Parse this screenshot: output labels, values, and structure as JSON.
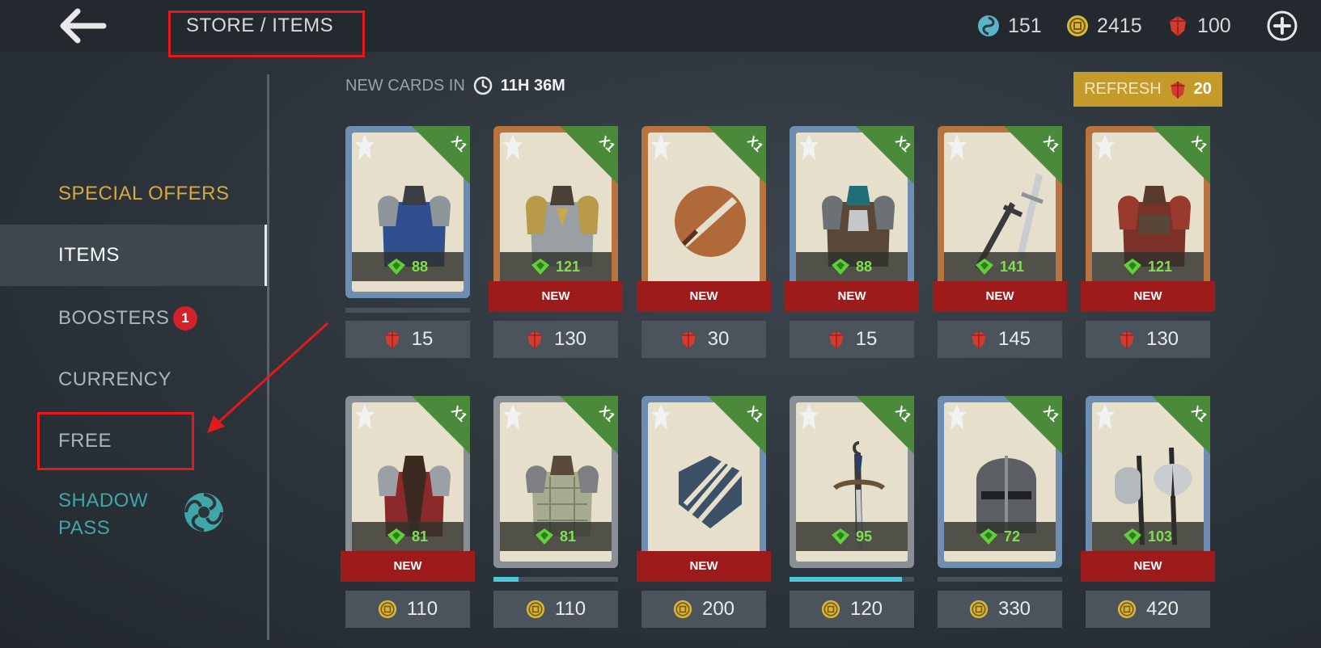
{
  "header": {
    "title": "STORE / ITEMS",
    "currencies": [
      {
        "name": "shadow-energy",
        "value": "151",
        "color": "#5bb3c8"
      },
      {
        "name": "coins",
        "value": "2415",
        "color": "#d8b53b"
      },
      {
        "name": "gems",
        "value": "100",
        "color": "#d23b2e"
      }
    ]
  },
  "sidebar": {
    "items": [
      {
        "label": "SPECIAL OFFERS",
        "color": "#d9a93a"
      },
      {
        "label": "ITEMS",
        "color": "#ffffff"
      },
      {
        "label": "BOOSTERS",
        "color": "#aeb4ba",
        "badge": "1"
      },
      {
        "label": "CURRENCY",
        "color": "#aeb4ba"
      },
      {
        "label": "FREE",
        "color": "#aeb4ba"
      },
      {
        "label": "SHADOW",
        "label2": "PASS",
        "color": "#3fa7a8"
      }
    ]
  },
  "main": {
    "new_cards_label": "NEW CARDS IN",
    "timer": "11H 36M",
    "refresh_label": "REFRESH",
    "refresh_cost": "20",
    "new_label": "NEW",
    "x1_label": "X1",
    "row1": [
      {
        "art": "blue-armor",
        "frame": "#6d8eb0",
        "power": "88",
        "new": false,
        "progress": 0,
        "price": "15",
        "currency": "gem"
      },
      {
        "art": "gold-armor",
        "frame": "#b7743f",
        "power": "121",
        "new": true,
        "price": "130",
        "currency": "gem"
      },
      {
        "art": "dagger-emblem",
        "frame": "#b7743f",
        "power": "",
        "new": true,
        "price": "30",
        "currency": "gem"
      },
      {
        "art": "skull-armor",
        "frame": "#6d8eb0",
        "power": "88",
        "new": true,
        "price": "15",
        "currency": "gem"
      },
      {
        "art": "twin-swords",
        "frame": "#b7743f",
        "power": "141",
        "new": true,
        "price": "145",
        "currency": "gem"
      },
      {
        "art": "red-armor",
        "frame": "#b7743f",
        "power": "121",
        "new": true,
        "price": "130",
        "currency": "gem"
      }
    ],
    "row2": [
      {
        "art": "red-vest",
        "frame": "#8a8f96",
        "power": "81",
        "new": true,
        "price": "110",
        "currency": "coin"
      },
      {
        "art": "padded-armor",
        "frame": "#8a8f96",
        "power": "81",
        "new": false,
        "progress": 0.2,
        "price": "110",
        "currency": "coin"
      },
      {
        "art": "swords-emblem",
        "frame": "#6d8eb0",
        "power": "",
        "new": true,
        "price": "200",
        "currency": "coin"
      },
      {
        "art": "sai-sword",
        "frame": "#8a8f96",
        "power": "95",
        "new": false,
        "progress": 0.9,
        "price": "120",
        "currency": "coin"
      },
      {
        "art": "knight-helm",
        "frame": "#6d8eb0",
        "power": "72",
        "new": false,
        "progress": 0,
        "price": "330",
        "currency": "coin"
      },
      {
        "art": "battle-axes",
        "frame": "#6d8eb0",
        "power": "103",
        "new": true,
        "price": "420",
        "currency": "coin"
      }
    ]
  },
  "colors": {
    "accent_red": "#e21a1a",
    "refresh_gold": "#c49a2a",
    "new_red": "#9e1b1b",
    "power_green": "#7ee04e"
  }
}
